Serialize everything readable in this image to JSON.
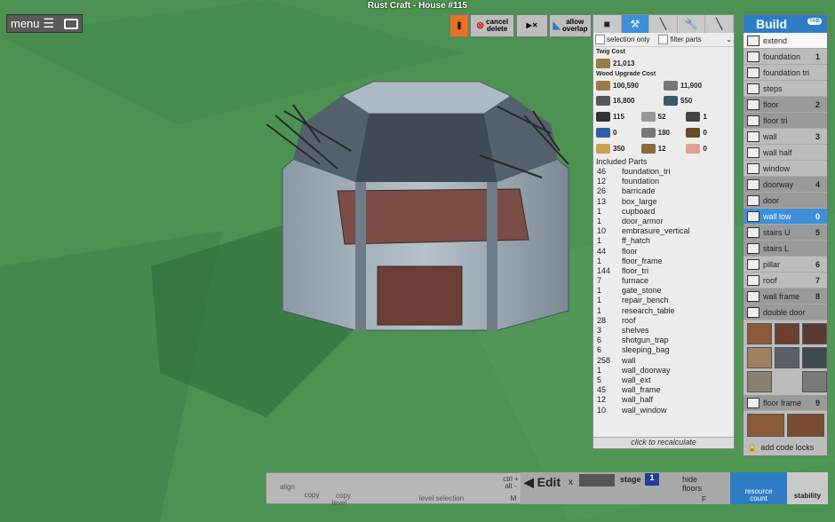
{
  "window": {
    "title": "Rust Craft - House #115"
  },
  "menu": {
    "label": "menu",
    "icons": [
      "hamburger-icon",
      "camera-icon"
    ]
  },
  "toolbar_top": {
    "cancel_delete": "cancel\ndelete",
    "allow_overlap": "allow\noverlap"
  },
  "cost_panel": {
    "tabs": [
      "cube",
      "hammer",
      "axe",
      "wrench",
      "tool"
    ],
    "selection_only": "selection only",
    "filter_parts": "filter parts",
    "twig_cost_title": "Twig Cost",
    "twig_cost_value": "21,013",
    "wood_upgrade_title": "Wood Upgrade Cost",
    "upgrade_costs": [
      "100,590",
      "11,900",
      "16,800",
      "550"
    ],
    "resources": [
      "115",
      "52",
      "1",
      "0",
      "180",
      "0",
      "350",
      "12",
      "0"
    ],
    "included_parts_title": "Included Parts",
    "parts": [
      {
        "q": "46",
        "name": "foundation_tri"
      },
      {
        "q": "12",
        "name": "foundation"
      },
      {
        "q": "26",
        "name": "barricade"
      },
      {
        "q": "13",
        "name": "box_large"
      },
      {
        "q": "1",
        "name": "cupboard"
      },
      {
        "q": "1",
        "name": "door_armor"
      },
      {
        "q": "10",
        "name": "embrasure_vertical"
      },
      {
        "q": "1",
        "name": "ff_hatch"
      },
      {
        "q": "44",
        "name": "floor"
      },
      {
        "q": "1",
        "name": "floor_frame"
      },
      {
        "q": "144",
        "name": "floor_tri"
      },
      {
        "q": "7",
        "name": "furnace"
      },
      {
        "q": "1",
        "name": "gate_stone"
      },
      {
        "q": "1",
        "name": "repair_bench"
      },
      {
        "q": "1",
        "name": "research_table"
      },
      {
        "q": "28",
        "name": "roof"
      },
      {
        "q": "3",
        "name": "shelves"
      },
      {
        "q": "6",
        "name": "shotgun_trap"
      },
      {
        "q": "6",
        "name": "sleeping_bag"
      },
      {
        "q": "258",
        "name": "wall"
      },
      {
        "q": "1",
        "name": "wall_doorway"
      },
      {
        "q": "5",
        "name": "wall_ext"
      },
      {
        "q": "45",
        "name": "wall_frame"
      },
      {
        "q": "12",
        "name": "wall_half"
      },
      {
        "q": "10",
        "name": "wall_window"
      }
    ],
    "recalculate": "click to recalculate"
  },
  "build_panel": {
    "title": "Build",
    "tab_key": "TAB",
    "items": [
      {
        "label": "extend",
        "num": "",
        "style": "white"
      },
      {
        "label": "foundation",
        "num": "1",
        "style": ""
      },
      {
        "label": "foundation tri",
        "num": "",
        "style": ""
      },
      {
        "label": "steps",
        "num": "",
        "style": ""
      },
      {
        "label": "floor",
        "num": "2",
        "style": "grey"
      },
      {
        "label": "floor tri",
        "num": "",
        "style": "grey"
      },
      {
        "label": "wall",
        "num": "3",
        "style": ""
      },
      {
        "label": "wall half",
        "num": "",
        "style": ""
      },
      {
        "label": "window",
        "num": "",
        "style": ""
      },
      {
        "label": "doorway",
        "num": "4",
        "style": "grey"
      },
      {
        "label": "door",
        "num": "",
        "style": "grey"
      },
      {
        "label": "wall low",
        "num": "0",
        "style": "sel"
      },
      {
        "label": "stairs U",
        "num": "5",
        "style": "grey"
      },
      {
        "label": "stairs L",
        "num": "",
        "style": "grey"
      },
      {
        "label": "pillar",
        "num": "6",
        "style": ""
      },
      {
        "label": "roof",
        "num": "7",
        "style": ""
      },
      {
        "label": "wall frame",
        "num": "8",
        "style": "grey"
      },
      {
        "label": "double door",
        "num": "",
        "style": "grey"
      }
    ],
    "floor_frame": {
      "label": "floor frame",
      "num": "9"
    },
    "add_code_locks": "add code locks"
  },
  "bottom_bar": {
    "align": "align",
    "copy": "copy",
    "copy_level": "copy\nlevel",
    "level_selection": "level selection",
    "ctrl_alt": "ctrl +\nalt -",
    "m_key": "M",
    "edit": "Edit",
    "x_key": "x",
    "stage_label": "stage",
    "stage_value": "1",
    "hide_floors": "hide\nfloors",
    "f_key": "F",
    "resource_count": "resource\ncount",
    "stability": "stability"
  }
}
